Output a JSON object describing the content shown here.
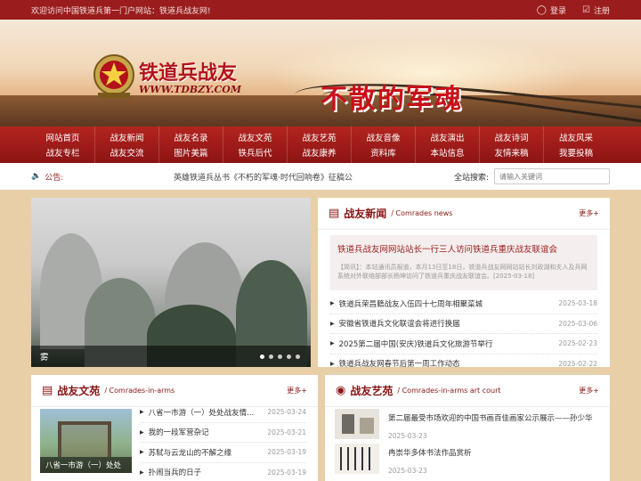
{
  "topbar": {
    "welcome": "欢迎访问中国铁道兵第一门户网站：铁道兵战友网!",
    "login": "登录",
    "register": "注册"
  },
  "banner": {
    "logo_title": "铁道兵战友",
    "logo_url": "WWW.TDBZY.COM",
    "slogan": "不散的军魂"
  },
  "nav": {
    "columns": [
      {
        "top": "网站首页",
        "bottom": "战友专栏"
      },
      {
        "top": "战友新闻",
        "bottom": "战友交流"
      },
      {
        "top": "战友名录",
        "bottom": "图片美篇"
      },
      {
        "top": "战友文苑",
        "bottom": "铁兵后代"
      },
      {
        "top": "战友艺苑",
        "bottom": "战友康养"
      },
      {
        "top": "战友音像",
        "bottom": "资料库"
      },
      {
        "top": "战友演出",
        "bottom": "本站信息"
      },
      {
        "top": "战友诗词",
        "bottom": "友情来稿"
      },
      {
        "top": "战友风采",
        "bottom": "我要投稿"
      }
    ]
  },
  "notice": {
    "label": "公告:",
    "text": "英雄铁道兵丛书《不朽的军魂·时代回响卷》征稿公",
    "search_label": "全站搜索:",
    "search_placeholder": "请输入关键词"
  },
  "slider": {
    "caption": "雾"
  },
  "news": {
    "title": "战友新闻",
    "subtitle": "/ Comrades news",
    "more": "更多+",
    "feature_title": "铁道兵战友网网站站长一行三人访问铁道兵重庆战友联谊会",
    "feature_desc": "【简讯】：本站通讯员报道，本月13日至18日，铁道兵战友网网站站长刘政湖和夫人及兵网系统对外联络部部长杨坤访问了铁道兵重庆战友联谊会。[2025-03-18]",
    "items": [
      {
        "title": "铁道兵荣昌籍战友入伍四十七周年相聚菜城",
        "date": "2025-03-18"
      },
      {
        "title": "安徽省铁道兵文化联谊会将进行换届",
        "date": "2025-03-06"
      },
      {
        "title": "2025第二届中国(安庆)铁道兵文化旅游节举行",
        "date": "2025-02-23"
      },
      {
        "title": "铁道兵战友网春节后第一周工作动态",
        "date": "2025-02-22"
      }
    ]
  },
  "wenyuan": {
    "title": "战友文苑",
    "subtitle": "/ Comrades-in-arms",
    "more": "更多+",
    "thumb_caption": "八省一市游（一）处处",
    "items": [
      {
        "title": "八省一市游（一）处处战友情...",
        "date": "2025-03-24"
      },
      {
        "title": "我的一段军营杂记",
        "date": "2025-03-21"
      },
      {
        "title": "苏轼与云龙山的不解之缘",
        "date": "2025-03-19"
      },
      {
        "title": "扑闹当兵的日子",
        "date": "2025-03-19"
      }
    ]
  },
  "yiyuan": {
    "title": "战友艺苑",
    "subtitle": "/ Comrades-in-arms art court",
    "more": "更多+",
    "items": [
      {
        "title": "第二届最受市场欢迎的中国书画百佳画家公示展示——孙少华",
        "date": "2025-03-23"
      },
      {
        "title": "冉崇华多体书法作品赏析",
        "date": "2025-03-23"
      }
    ]
  }
}
